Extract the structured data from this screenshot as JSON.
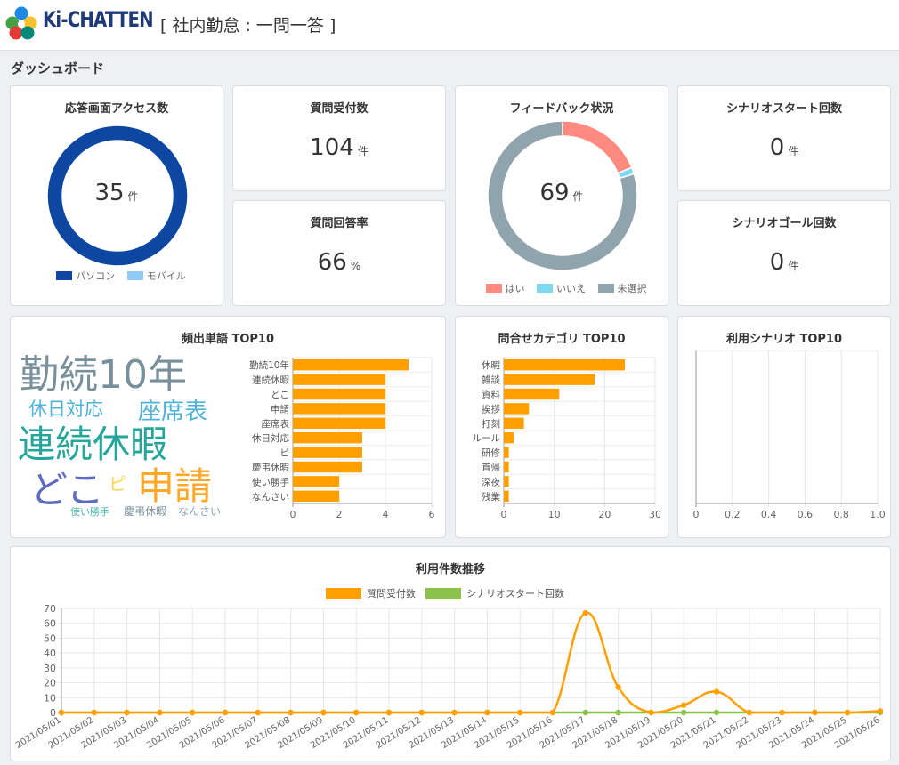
{
  "header": {
    "brand": "Ki-CHATTEN",
    "title": "[ 社内勤怠 : 一問一答 ]"
  },
  "section_title": "ダッシュボード",
  "cards": {
    "access": {
      "title": "応答画面アクセス数",
      "value": "35",
      "unit": "件",
      "legend": [
        "パソコン",
        "モバイル"
      ],
      "colors": [
        "#0d47a1",
        "#90caf9"
      ],
      "values": [
        35,
        0
      ]
    },
    "received": {
      "title": "質問受付数",
      "value": "104",
      "unit": "件"
    },
    "answer_rate": {
      "title": "質問回答率",
      "value": "66",
      "unit": "%"
    },
    "feedback": {
      "title": "フィードバック状況",
      "value": "69",
      "unit": "件",
      "legend": [
        "はい",
        "いいえ",
        "未選択"
      ],
      "colors": [
        "#ff8a80",
        "#80d8f0",
        "#90a4ae"
      ],
      "values": [
        13,
        1,
        55
      ]
    },
    "scenario_start": {
      "title": "シナリオスタート回数",
      "value": "0",
      "unit": "件"
    },
    "scenario_goal": {
      "title": "シナリオゴール回数",
      "value": "0",
      "unit": "件"
    },
    "top_words": {
      "title": "頻出単語 TOP10"
    },
    "inquiry_category": {
      "title": "問合せカテゴリ TOP10"
    },
    "used_scenario": {
      "title": "利用シナリオ TOP10"
    },
    "usage_trend": {
      "title": "利用件数推移"
    }
  },
  "wordcloud": [
    {
      "text": "勤続10年",
      "color": "#78909c"
    },
    {
      "text": "休日対応",
      "color": "#4fb3d9"
    },
    {
      "text": "座席表",
      "color": "#4fb3d9"
    },
    {
      "text": "連続休暇",
      "color": "#26a69a"
    },
    {
      "text": "どこ",
      "color": "#5c6bc0"
    },
    {
      "text": "ピ",
      "color": "#ffd54f"
    },
    {
      "text": "申請",
      "color": "#ffa726"
    },
    {
      "text": "使い勝手",
      "color": "#4db6ac"
    },
    {
      "text": "慶弔休暇",
      "color": "#78909c"
    },
    {
      "text": "なんさい",
      "color": "#90a4ae"
    }
  ],
  "chart_data": [
    {
      "type": "bar",
      "orientation": "horizontal",
      "categories": [
        "勤続10年",
        "連続休暇",
        "どこ",
        "申請",
        "座席表",
        "休日対応",
        "ピ",
        "慶弔休暇",
        "使い勝手",
        "なんさい"
      ],
      "values": [
        5,
        4,
        4,
        4,
        4,
        3,
        3,
        3,
        2,
        2
      ],
      "xlim": [
        0,
        6
      ],
      "xticks": [
        "0",
        "2",
        "4",
        "6"
      ],
      "color": "#ffa000"
    },
    {
      "type": "bar",
      "orientation": "horizontal",
      "categories": [
        "休暇",
        "雑談",
        "資料",
        "挨拶",
        "打刻",
        "ルール",
        "研修",
        "直帰",
        "深夜",
        "残業"
      ],
      "values": [
        24,
        18,
        11,
        5,
        4,
        2,
        1,
        1,
        1,
        1
      ],
      "xlim": [
        0,
        30
      ],
      "xticks": [
        "0",
        "10",
        "20",
        "30"
      ],
      "color": "#ffa000"
    },
    {
      "type": "bar",
      "orientation": "horizontal",
      "categories": [],
      "values": [],
      "xlim": [
        0,
        1
      ],
      "xticks": [
        "0",
        "0.2",
        "0.4",
        "0.6",
        "0.8",
        "1.0"
      ]
    },
    {
      "type": "line",
      "x": [
        "2021/05/01",
        "2021/05/02",
        "2021/05/03",
        "2021/05/04",
        "2021/05/05",
        "2021/05/06",
        "2021/05/07",
        "2021/05/08",
        "2021/05/09",
        "2021/05/10",
        "2021/05/11",
        "2021/05/12",
        "2021/05/13",
        "2021/05/14",
        "2021/05/15",
        "2021/05/16",
        "2021/05/17",
        "2021/05/18",
        "2021/05/19",
        "2021/05/20",
        "2021/05/21",
        "2021/05/22",
        "2021/05/23",
        "2021/05/24",
        "2021/05/25",
        "2021/05/26"
      ],
      "series": [
        {
          "name": "質問受付数",
          "color": "#ffa000",
          "values": [
            0,
            0,
            0,
            0,
            0,
            0,
            0,
            0,
            0,
            0,
            0,
            0,
            0,
            0,
            0,
            0,
            67,
            17,
            0,
            5,
            14,
            0,
            0,
            0,
            0,
            1
          ]
        },
        {
          "name": "シナリオスタート回数",
          "color": "#8bc34a",
          "values": [
            0,
            0,
            0,
            0,
            0,
            0,
            0,
            0,
            0,
            0,
            0,
            0,
            0,
            0,
            0,
            0,
            0,
            0,
            0,
            0,
            0,
            0,
            0,
            0,
            0,
            0
          ]
        }
      ],
      "ylim": [
        0,
        70
      ],
      "yticks": [
        "0",
        "10",
        "20",
        "30",
        "40",
        "50",
        "60",
        "70"
      ],
      "legend": "top-center"
    }
  ]
}
